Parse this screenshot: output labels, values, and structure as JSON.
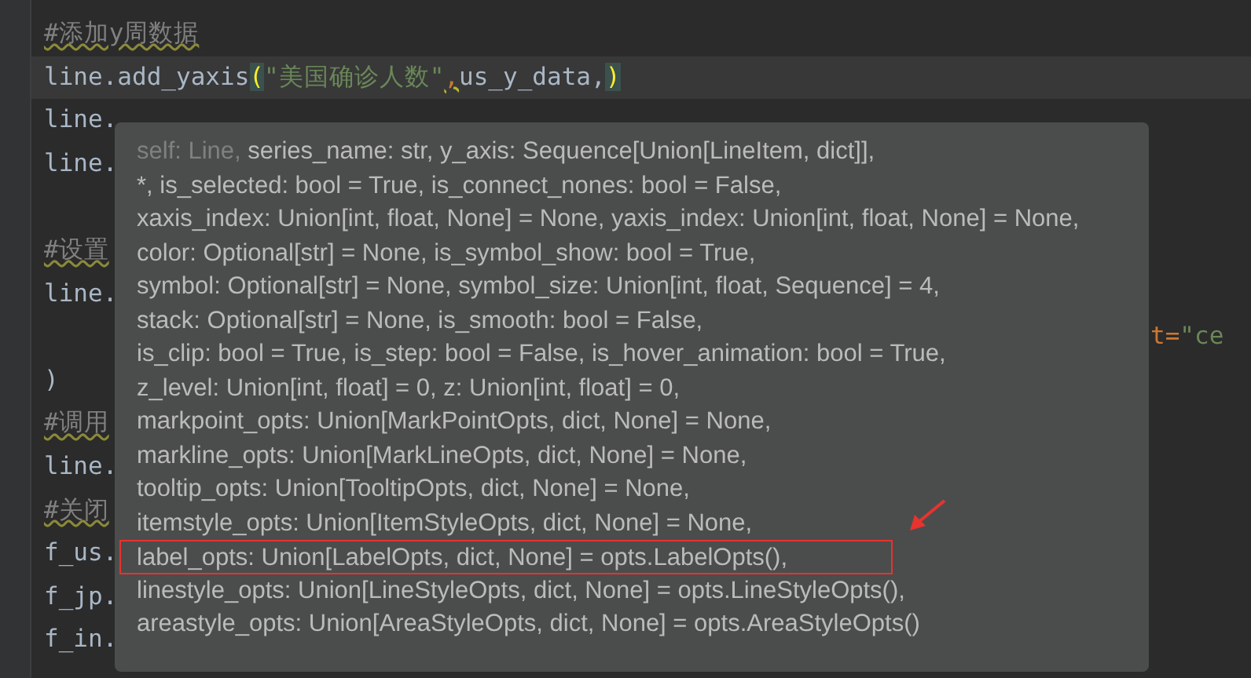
{
  "editor": {
    "lines": [
      {
        "current": false,
        "fragments": [
          {
            "kind": "comment",
            "text": "#添加y周数据"
          }
        ]
      },
      {
        "current": true,
        "fragments": [
          {
            "kind": "plain",
            "text": "line.add_yaxis"
          },
          {
            "kind": "brace",
            "text": "("
          },
          {
            "kind": "string",
            "text": "\"美国确诊人数\""
          },
          {
            "kind": "warn",
            "text": ","
          },
          {
            "kind": "plain",
            "text": "us_y_data,"
          },
          {
            "kind": "brace",
            "text": ")"
          }
        ]
      },
      {
        "current": false,
        "fragments": [
          {
            "kind": "plain",
            "text": "line."
          }
        ]
      },
      {
        "current": false,
        "fragments": [
          {
            "kind": "plain",
            "text": "line."
          }
        ]
      },
      {
        "current": false
      },
      {
        "current": false,
        "fragments": [
          {
            "kind": "comment",
            "text": "#设置"
          }
        ]
      },
      {
        "current": false,
        "fragments": [
          {
            "kind": "plain",
            "text": "line."
          }
        ]
      },
      {
        "current": false,
        "right": [
          {
            "kind": "keyword",
            "text": "t="
          },
          {
            "kind": "string",
            "text": "\"ce"
          }
        ]
      },
      {
        "current": false,
        "fragments": [
          {
            "kind": "plain",
            "text": ")"
          }
        ]
      },
      {
        "current": false,
        "fragments": [
          {
            "kind": "comment",
            "text": "#调用"
          }
        ]
      },
      {
        "current": false,
        "fragments": [
          {
            "kind": "plain",
            "text": "line."
          }
        ]
      },
      {
        "current": false,
        "fragments": [
          {
            "kind": "comment",
            "text": "#关闭"
          }
        ]
      },
      {
        "current": false,
        "fragments": [
          {
            "kind": "plain",
            "text": "f_us."
          }
        ]
      },
      {
        "current": false,
        "fragments": [
          {
            "kind": "plain",
            "text": "f_jp."
          }
        ]
      },
      {
        "current": false,
        "fragments": [
          {
            "kind": "plain",
            "text": "f_in."
          }
        ]
      }
    ]
  },
  "parameter_popup": {
    "lines": [
      {
        "boxed": false,
        "parts": [
          {
            "kind": "hint",
            "text": "self: Line,"
          },
          {
            "kind": "param",
            "text": " series_name: str, y_axis: Sequence[Union[LineItem, dict]],"
          }
        ]
      },
      {
        "boxed": false,
        "parts": [
          {
            "kind": "param",
            "text": "*, is_selected: bool = True, is_connect_nones: bool = False,"
          }
        ]
      },
      {
        "boxed": false,
        "parts": [
          {
            "kind": "param",
            "text": "xaxis_index: Union[int, float, None] = None, yaxis_index: Union[int, float, None] = None,"
          }
        ]
      },
      {
        "boxed": false,
        "parts": [
          {
            "kind": "param",
            "text": "color: Optional[str] = None, is_symbol_show: bool = True,"
          }
        ]
      },
      {
        "boxed": false,
        "parts": [
          {
            "kind": "param",
            "text": "symbol: Optional[str] = None, symbol_size: Union[int, float, Sequence] = 4,"
          }
        ]
      },
      {
        "boxed": false,
        "parts": [
          {
            "kind": "param",
            "text": "stack: Optional[str] = None, is_smooth: bool = False,"
          }
        ]
      },
      {
        "boxed": false,
        "parts": [
          {
            "kind": "param",
            "text": "is_clip: bool = True, is_step: bool = False, is_hover_animation: bool = True,"
          }
        ]
      },
      {
        "boxed": false,
        "parts": [
          {
            "kind": "param",
            "text": "z_level: Union[int, float] = 0, z: Union[int, float] = 0,"
          }
        ]
      },
      {
        "boxed": false,
        "parts": [
          {
            "kind": "param",
            "text": "markpoint_opts: Union[MarkPointOpts, dict, None] = None,"
          }
        ]
      },
      {
        "boxed": false,
        "parts": [
          {
            "kind": "param",
            "text": "markline_opts: Union[MarkLineOpts, dict, None] = None,"
          }
        ]
      },
      {
        "boxed": false,
        "parts": [
          {
            "kind": "param",
            "text": "tooltip_opts: Union[TooltipOpts, dict, None] = None,"
          }
        ]
      },
      {
        "boxed": false,
        "parts": [
          {
            "kind": "param",
            "text": "itemstyle_opts: Union[ItemStyleOpts, dict, None] = None,"
          }
        ]
      },
      {
        "boxed": true,
        "parts": [
          {
            "kind": "param",
            "text": "label_opts: Union[LabelOpts, dict, None] = opts.LabelOpts(),"
          }
        ]
      },
      {
        "boxed": false,
        "parts": [
          {
            "kind": "param",
            "text": "linestyle_opts: Union[LineStyleOpts, dict, None] = opts.LineStyleOpts(),"
          }
        ]
      },
      {
        "boxed": false,
        "parts": [
          {
            "kind": "param",
            "text": "areastyle_opts: Union[AreaStyleOpts, dict, None] = opts.AreaStyleOpts()"
          }
        ]
      }
    ]
  }
}
